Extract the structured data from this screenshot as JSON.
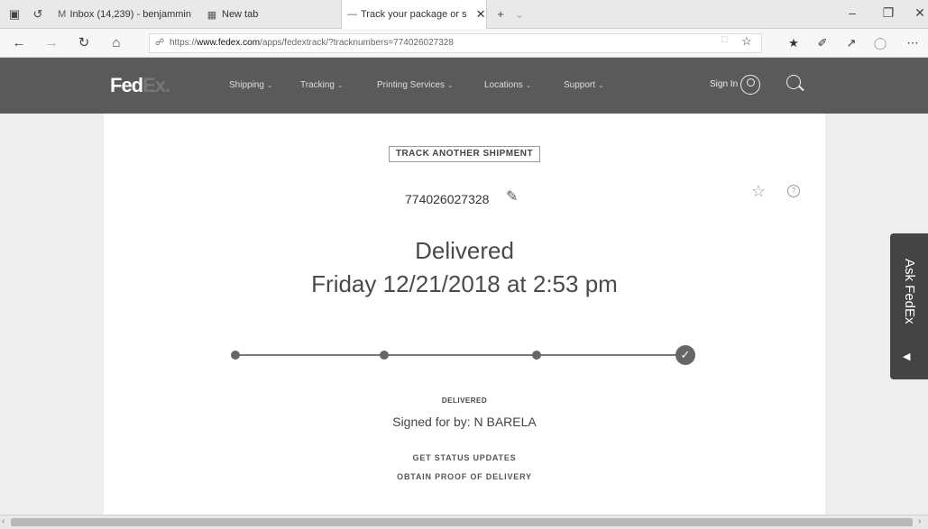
{
  "browser": {
    "tabs": [
      {
        "label": "Inbox (14,239) - benjammin",
        "icon": "mail-icon"
      },
      {
        "label": "New tab",
        "icon": "new-tab-icon"
      },
      {
        "label": "Track your package or s",
        "icon": "fedex-favicon",
        "active": true
      }
    ],
    "address": {
      "prefix": "https://",
      "domain": "www.fedex.com",
      "path": "/apps/fedextrack/?tracknumbers=774026027328"
    }
  },
  "fedex": {
    "logo_fed": "Fed",
    "logo_ex": "Ex.",
    "nav": [
      "Shipping",
      "Tracking",
      "Printing Services",
      "Locations",
      "Support"
    ],
    "sign_in": "Sign In"
  },
  "tracking": {
    "track_another": "TRACK ANOTHER SHIPMENT",
    "number": "774026027328",
    "status": "Delivered",
    "date": "Friday 12/21/2018 at 2:53 pm",
    "status_label": "DELIVERED",
    "signed_for": "Signed for by: N BARELA",
    "get_updates": "GET STATUS UPDATES",
    "proof": "OBTAIN PROOF OF DELIVERY",
    "progress_completed_steps": 4,
    "progress_total_steps": 4
  },
  "side_tab": {
    "label": "Ask FedEx"
  },
  "colors": {
    "header_bg": "#5a5a5a",
    "progress": "#666666",
    "side_tab_bg": "#444444"
  }
}
